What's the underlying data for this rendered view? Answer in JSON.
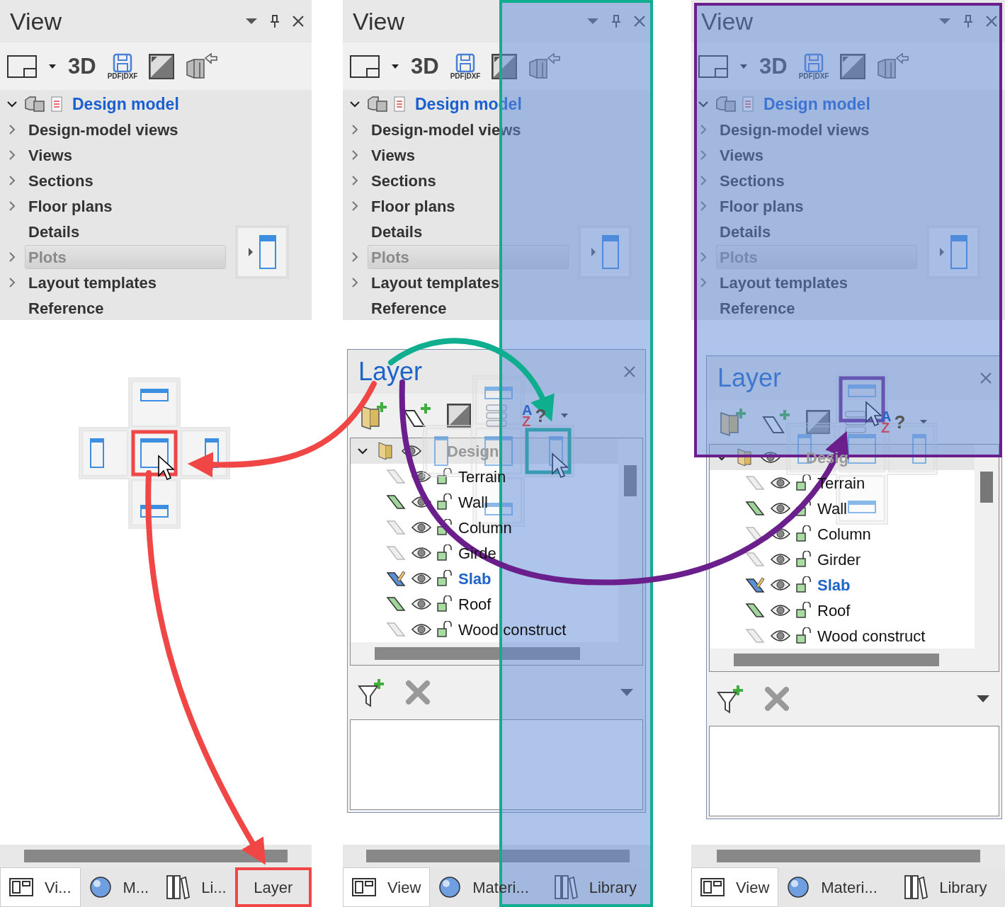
{
  "columns": [
    {
      "kind": "guide",
      "view_panel": {
        "title": "View",
        "toolbar": {
          "three_d": "3D",
          "export": "PDF|DXF"
        },
        "tree": {
          "label": "Design model",
          "expanded": true,
          "children": [
            {
              "label": "Design-model views",
              "expandable": true,
              "highlighted": false
            },
            {
              "label": "Views",
              "expandable": true,
              "highlighted": false
            },
            {
              "label": "Sections",
              "expandable": true,
              "highlighted": false
            },
            {
              "label": "Floor plans",
              "expandable": true,
              "highlighted": false
            },
            {
              "label": "Details",
              "expandable": false,
              "highlighted": false
            },
            {
              "label": "Plots",
              "expandable": true,
              "highlighted": true
            },
            {
              "label": "Layout templates",
              "expandable": true,
              "highlighted": false
            },
            {
              "label": "Reference",
              "expandable": false,
              "highlighted": false
            }
          ]
        }
      },
      "tabs": [
        {
          "label": "Vi...",
          "selected": true,
          "marked": false
        },
        {
          "label": "M...",
          "selected": false,
          "marked": false
        },
        {
          "label": "Li...",
          "selected": false,
          "marked": false
        },
        {
          "label": "Layer",
          "selected": false,
          "marked": true
        }
      ]
    },
    {
      "kind": "floating",
      "view_panel": {
        "title": "View",
        "toolbar": {
          "three_d": "3D",
          "export": "PDF|DXF"
        },
        "tree": {
          "label": "Design model",
          "expanded": true,
          "children": [
            {
              "label": "Design-model views",
              "expandable": true,
              "highlighted": false
            },
            {
              "label": "Views",
              "expandable": true,
              "highlighted": false
            },
            {
              "label": "Sections",
              "expandable": true,
              "highlighted": false
            },
            {
              "label": "Floor plans",
              "expandable": true,
              "highlighted": false
            },
            {
              "label": "Details",
              "expandable": false,
              "highlighted": false
            },
            {
              "label": "Plots",
              "expandable": true,
              "highlighted": true
            },
            {
              "label": "Layout templates",
              "expandable": true,
              "highlighted": false
            },
            {
              "label": "Reference",
              "expandable": false,
              "highlighted": false
            }
          ]
        }
      },
      "layer_panel": {
        "title": "Layer",
        "sort": {
          "top": "A",
          "bottom": "Z",
          "help": "?"
        },
        "root": "Design",
        "rows": [
          {
            "label": "Terrain",
            "kind": "empty"
          },
          {
            "label": "Wall",
            "kind": "filled"
          },
          {
            "label": "Column",
            "kind": "empty"
          },
          {
            "label": "Girde",
            "kind": "empty"
          },
          {
            "label": "Slab",
            "kind": "current"
          },
          {
            "label": "Roof",
            "kind": "filled"
          },
          {
            "label": "Wood construct",
            "kind": "empty"
          }
        ]
      },
      "tabs": [
        {
          "label": "View",
          "selected": true,
          "marked": false
        },
        {
          "label": "Materi...",
          "selected": false,
          "marked": false
        },
        {
          "label": "Library",
          "selected": false,
          "marked": false
        }
      ]
    },
    {
      "kind": "docked",
      "view_panel": {
        "title": "View",
        "toolbar": {
          "three_d": "3D",
          "export": "PDF|DXF"
        },
        "tree": {
          "label": "Design model",
          "expanded": true,
          "children": [
            {
              "label": "Design-model views",
              "expandable": true,
              "highlighted": false
            },
            {
              "label": "Views",
              "expandable": true,
              "highlighted": false
            },
            {
              "label": "Sections",
              "expandable": true,
              "highlighted": false
            },
            {
              "label": "Floor plans",
              "expandable": true,
              "highlighted": false
            },
            {
              "label": "Details",
              "expandable": false,
              "highlighted": false
            },
            {
              "label": "Plots",
              "expandable": true,
              "highlighted": true
            },
            {
              "label": "Layout templates",
              "expandable": true,
              "highlighted": false
            },
            {
              "label": "Reference",
              "expandable": false,
              "highlighted": false
            }
          ]
        }
      },
      "layer_panel": {
        "title": "Layer",
        "sort": {
          "top": "A",
          "bottom": "Z",
          "help": "?"
        },
        "root": "Desig",
        "rows": [
          {
            "label": "Terrain",
            "kind": "empty"
          },
          {
            "label": "Wall",
            "kind": "filled"
          },
          {
            "label": "Column",
            "kind": "empty"
          },
          {
            "label": "Girder",
            "kind": "empty"
          },
          {
            "label": "Slab",
            "kind": "current"
          },
          {
            "label": "Roof",
            "kind": "filled"
          },
          {
            "label": "Wood construct",
            "kind": "empty"
          }
        ]
      },
      "tabs": [
        {
          "label": "View",
          "selected": true,
          "marked": false
        },
        {
          "label": "Materi...",
          "selected": false,
          "marked": false
        },
        {
          "label": "Library",
          "selected": false,
          "marked": false
        }
      ]
    }
  ]
}
